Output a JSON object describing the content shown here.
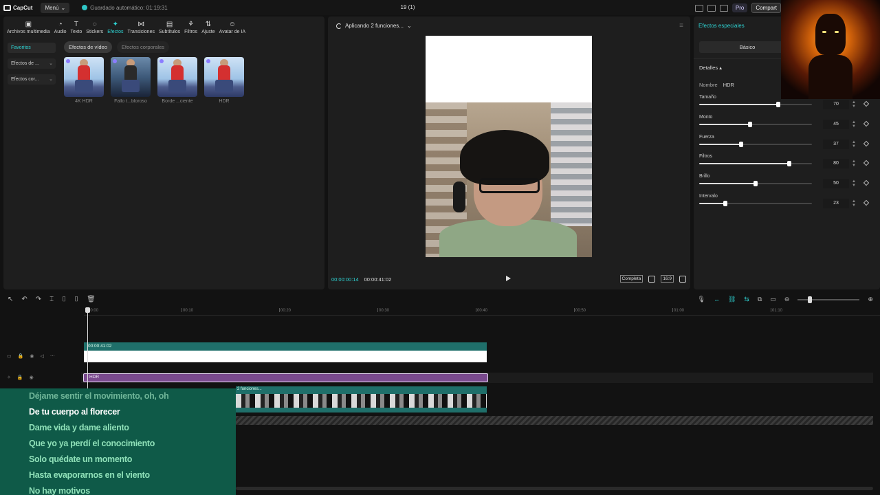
{
  "topbar": {
    "logo": "CapCut",
    "menu_label": "Menú",
    "autosave": "Guardado automático: 01:19:31",
    "project_title": "19 (1)",
    "pro_label": "Pro",
    "share_label": "Compart"
  },
  "toolbar": [
    {
      "label": "Archivos multimedia",
      "glyph": "▣"
    },
    {
      "label": "Audio",
      "glyph": "◔"
    },
    {
      "label": "Texto",
      "glyph": "T"
    },
    {
      "label": "Stickers",
      "glyph": "◌"
    },
    {
      "label": "Efectos",
      "glyph": "✦"
    },
    {
      "label": "Transiciones",
      "glyph": "⋈"
    },
    {
      "label": "Subtítulos",
      "glyph": "▤"
    },
    {
      "label": "Filtros",
      "glyph": "⚘"
    },
    {
      "label": "Ajuste",
      "glyph": "⇅"
    },
    {
      "label": "Avatar de IA",
      "glyph": "☺"
    }
  ],
  "sidenav": {
    "favorites": "Favoritos",
    "video_effects": "Efectos de ...",
    "body_effects": "Efectos cor..."
  },
  "chips": {
    "video": "Efectos de vídeo",
    "body": "Efectos corporales"
  },
  "effects": [
    {
      "caption": "4K HDR"
    },
    {
      "caption": "Fallo t...bloroso"
    },
    {
      "caption": "Borde ...ciente"
    },
    {
      "caption": "HDR"
    }
  ],
  "player": {
    "status": "Aplicando 2 funciones...",
    "current_time": "00:00:00:14",
    "total_time": "00:00:41:02",
    "full_label": "Completa",
    "ratio_label": "16:9"
  },
  "inspector": {
    "title": "Efectos especiales",
    "tab_basic": "Básico",
    "details": "Detalles",
    "name_label": "Nombre",
    "name_value": "HDR",
    "params": [
      {
        "label": "Tamaño",
        "value": 70
      },
      {
        "label": "Monto",
        "value": 45
      },
      {
        "label": "Fuerza",
        "value": 37
      },
      {
        "label": "Filtros",
        "value": 80
      },
      {
        "label": "Brillo",
        "value": 50
      },
      {
        "label": "Intervalo",
        "value": 23
      }
    ]
  },
  "timeline": {
    "ticks": [
      "00:00",
      "00:10",
      "00:20",
      "00:30",
      "00:40",
      "00:50",
      "01:00",
      "01:10"
    ],
    "white_clip_label": "00:00:41:02",
    "hdr_clip_label": "HDR",
    "video_clip_label": "2 funciones..."
  },
  "lyrics": [
    {
      "text": "Déjame sentir el movimiento, oh, oh",
      "state": "dim"
    },
    {
      "text": "De tu cuerpo al florecer",
      "state": "current"
    },
    {
      "text": "Dame vida y dame aliento",
      "state": "next"
    },
    {
      "text": "Que yo ya perdí el conocimiento",
      "state": "next"
    },
    {
      "text": "Solo quédate un momento",
      "state": "next"
    },
    {
      "text": "Hasta evaporarnos en el viento",
      "state": "next"
    },
    {
      "text": "No hay motivos",
      "state": "next"
    }
  ]
}
